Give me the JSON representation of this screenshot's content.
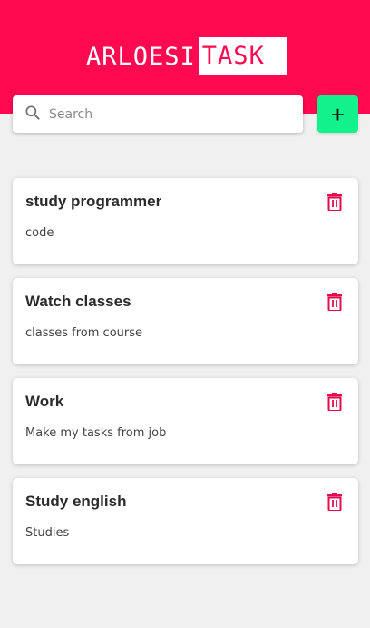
{
  "header": {
    "brand_part1": "ARLOESI",
    "brand_part2": "TASK",
    "brand_color": "#ff0a50"
  },
  "search": {
    "placeholder": "Search",
    "icon": "search-icon"
  },
  "add_button": {
    "icon": "plus-icon",
    "label": "+",
    "color": "#12f28c"
  },
  "tasks": [
    {
      "title": "study programmer",
      "description": "code",
      "action_icon": "trash-icon"
    },
    {
      "title": "Watch classes",
      "description": "classes from course",
      "action_icon": "trash-icon"
    },
    {
      "title": "Work",
      "description": "Make my tasks from job",
      "action_icon": "trash-icon"
    },
    {
      "title": "Study english",
      "description": "Studies",
      "action_icon": "trash-icon"
    }
  ]
}
